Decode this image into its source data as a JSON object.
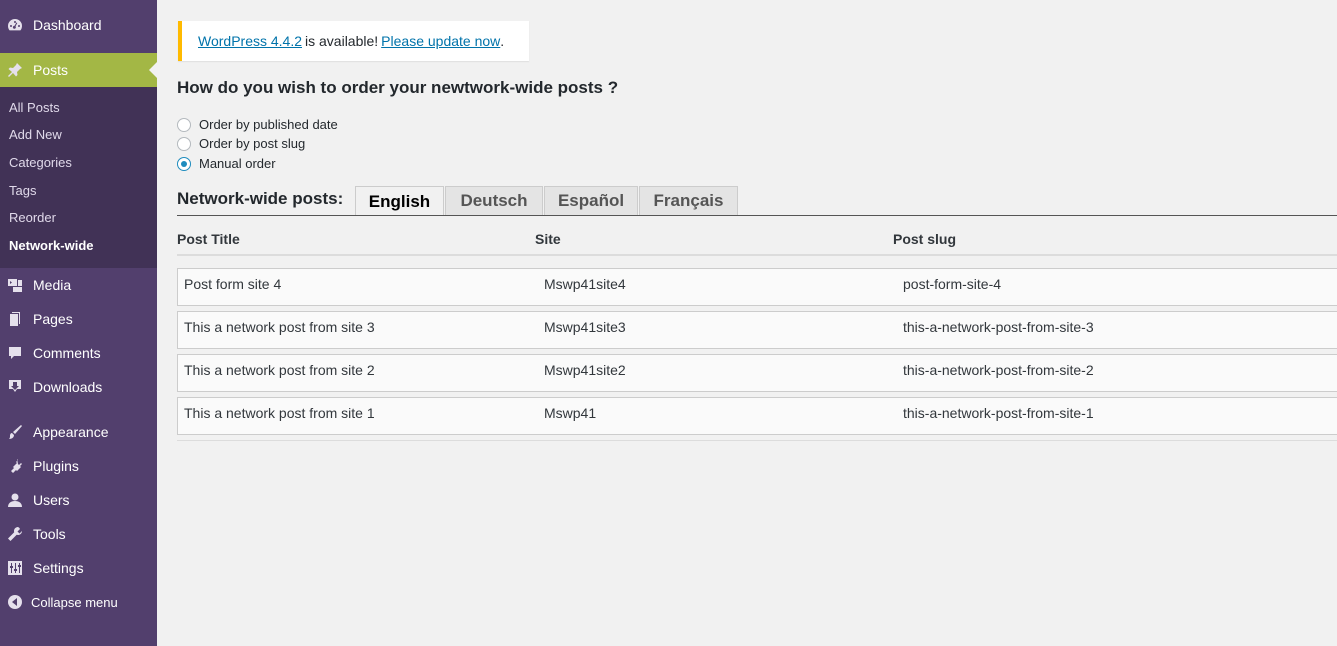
{
  "sidebar": {
    "dashboard": "Dashboard",
    "posts": "Posts",
    "submenu": [
      "All Posts",
      "Add New",
      "Categories",
      "Tags",
      "Reorder",
      "Network-wide"
    ],
    "media": "Media",
    "pages": "Pages",
    "comments": "Comments",
    "downloads": "Downloads",
    "appearance": "Appearance",
    "plugins": "Plugins",
    "users": "Users",
    "tools": "Tools",
    "settings": "Settings",
    "collapse": "Collapse menu"
  },
  "notice": {
    "version_link": "WordPress 4.4.2",
    "middle_text": "is available!",
    "update_link": "Please update now",
    "end_text": "."
  },
  "question": "How do you wish to order your newtwork-wide posts ?",
  "order_options": [
    {
      "label": "Order by published date",
      "checked": false
    },
    {
      "label": "Order by post slug",
      "checked": false
    },
    {
      "label": "Manual order",
      "checked": true
    }
  ],
  "tabs_label": "Network-wide posts:",
  "tabs": [
    "English",
    "Deutsch",
    "Español",
    "Français"
  ],
  "table": {
    "headers": [
      "Post Title",
      "Site",
      "Post slug"
    ],
    "rows": [
      [
        "Post form site 4",
        "Mswp41site4",
        "post-form-site-4"
      ],
      [
        "This a network post from site 3",
        "Mswp41site3",
        "this-a-network-post-from-site-3"
      ],
      [
        "This a network post from site 2",
        "Mswp41site2",
        "this-a-network-post-from-site-2"
      ],
      [
        "This a network post from site 1",
        "Mswp41",
        "this-a-network-post-from-site-1"
      ]
    ]
  },
  "colors": {
    "sidebar_bg": "#523f6d",
    "submenu_bg": "#413256",
    "active_accent": "#a3b745",
    "notice_border": "#ffba00",
    "link": "#0073aa",
    "radio_checked": "#1e8cbe"
  }
}
